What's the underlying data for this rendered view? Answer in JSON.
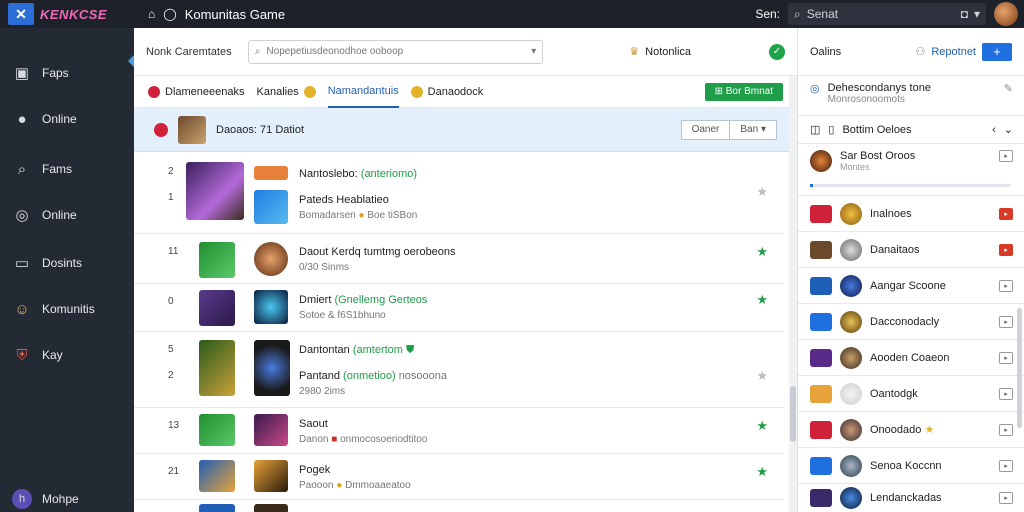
{
  "app": {
    "logo_text": "KENKCSE",
    "title": "Komunitas Game"
  },
  "topbar": {
    "label": "Sen:",
    "search_placeholder": "Senat"
  },
  "sidebar": {
    "items": [
      {
        "label": "Faps",
        "icon": "controller-icon"
      },
      {
        "label": "Online",
        "icon": "user-icon"
      },
      {
        "label": "Fams",
        "icon": "search-icon"
      },
      {
        "label": "Online",
        "icon": "compass-icon"
      },
      {
        "label": "Dosints",
        "icon": "screen-icon"
      },
      {
        "label": "Komunitis",
        "icon": "avatar-icon"
      },
      {
        "label": "Kay",
        "icon": "shield-icon"
      }
    ],
    "footer": {
      "label": "Mohpe",
      "initial": "h"
    }
  },
  "filter": {
    "label": "Nonk Caremtates",
    "placeholder": "Nopepetiusdeonodhoe ooboop",
    "notif_label": "Notonlica"
  },
  "tabs": [
    {
      "label": "Dlameneeenaks",
      "color": "#d0213b"
    },
    {
      "label": "Kanalies",
      "color": "#e2b32a"
    },
    {
      "label": "Namandantuis",
      "color": "#e2b32a",
      "active": true
    },
    {
      "label": "Danaodock",
      "color": "#e2b32a"
    }
  ],
  "tab_button": "Bor Bmnat",
  "selected": {
    "title": "Daoaos: 71 Datiot",
    "btn1": "Oaner",
    "btn2": "Ban"
  },
  "rows": [
    {
      "num1": "2",
      "num2": "1",
      "title": "Nantoslebo:",
      "title_green": "(anteriomo)",
      "line2": "Pateds Heablatieo",
      "sub": "Bomadarsen",
      "sub2": "Boe tiSBon",
      "star": "off"
    },
    {
      "num1": "11",
      "title": "Daout Kerdq tumtmg oerobeons",
      "sub": "0/30 Sinms",
      "star": "on"
    },
    {
      "num1": "0",
      "title": "Dmiert",
      "title_green": "(Gnellemg Gerteos",
      "sub": "Sotoe & f6S1bhuno",
      "star": "on"
    },
    {
      "num1": "5",
      "num2": "2",
      "title": "Dantontan",
      "title_green": "(amtertom",
      "line2": "Pantand",
      "line2_green": "(onmetioo)",
      "line2_rest": "nosooona",
      "sub": "2980 2ims",
      "star": "off"
    },
    {
      "num1": "13",
      "title": "Saout",
      "sub": "Danon",
      "sub2": "onmocosoeriodtitoo",
      "star": "on"
    },
    {
      "num1": "21",
      "title": "Pogek",
      "sub": "Paooon",
      "sub2": "Dmmoaaeatoo",
      "star": "on"
    },
    {
      "num1": "",
      "title": "",
      "sub": "",
      "star": ""
    }
  ],
  "right": {
    "head_label": "Oalins",
    "report_label": "Repotnet",
    "row_info": "Dehescondanys tone",
    "row_info_sub": "Monrosonoomots",
    "section": "Bottim Oeloes",
    "first": {
      "name": "Sar Bost Oroos",
      "sub": "Montes"
    },
    "items": [
      {
        "name": "Inalnoes",
        "act": "red"
      },
      {
        "name": "Danaitaos",
        "act": "red"
      },
      {
        "name": "Aangar Scoone",
        "act": "normal"
      },
      {
        "name": "Dacconodacly",
        "act": "normal"
      },
      {
        "name": "Aooden Coaeon",
        "act": "normal"
      },
      {
        "name": "Oantodgk",
        "act": "normal"
      },
      {
        "name": "Onoodado",
        "act": "normal"
      },
      {
        "name": "Senoa Koccnn",
        "act": "normal"
      },
      {
        "name": "Lendanckadas",
        "act": "normal"
      }
    ]
  }
}
